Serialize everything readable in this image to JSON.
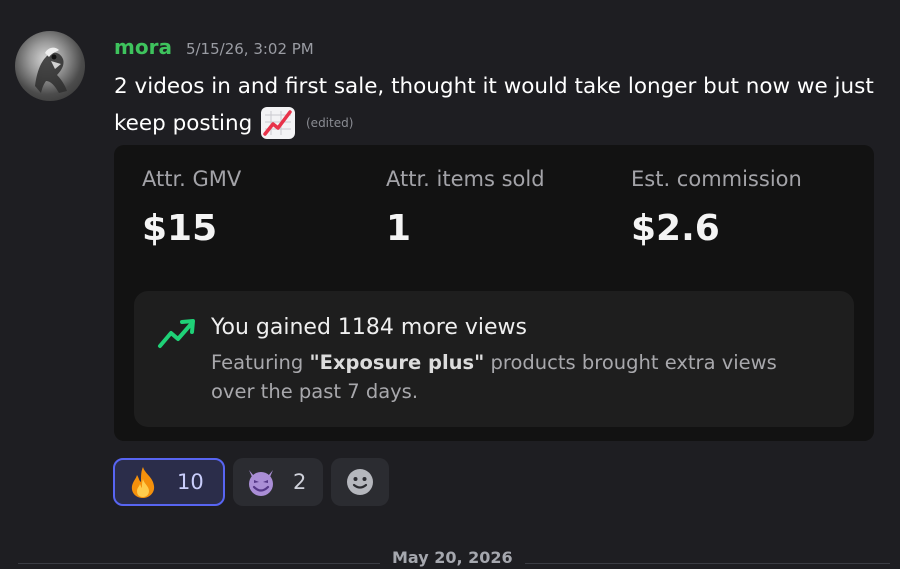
{
  "message": {
    "author": "mora",
    "timestamp": "5/15/26, 3:02 PM",
    "text": "2 videos in and first sale, thought it would take longer but now we just keep posting",
    "emoji": "chart-increasing-emoji",
    "edited_label": "(edited)"
  },
  "embed": {
    "stats": [
      {
        "label": "Attr. GMV",
        "value": "$15"
      },
      {
        "label": "Attr. items sold",
        "value": "1"
      },
      {
        "label": "Est. commission",
        "value": "$2.6"
      }
    ],
    "highlight": {
      "icon": "trending-up-icon",
      "title": "You gained 1184 more views",
      "desc_prefix": "Featuring",
      "desc_bold": "\"Exposure plus\"",
      "desc_suffix": "products brought extra views over the past 7 days."
    }
  },
  "reactions": [
    {
      "emoji": "fire-emoji",
      "count": "10",
      "active": true
    },
    {
      "emoji": "smiling-imp-emoji",
      "count": "2",
      "active": false
    }
  ],
  "add_reaction_icon": "add-reaction-icon",
  "date_divider": "May 20, 2026",
  "colors": {
    "username": "#3ec35d",
    "accent_green": "#1fd177",
    "reaction_active_border": "#5865f2",
    "background": "#1e1e22"
  }
}
